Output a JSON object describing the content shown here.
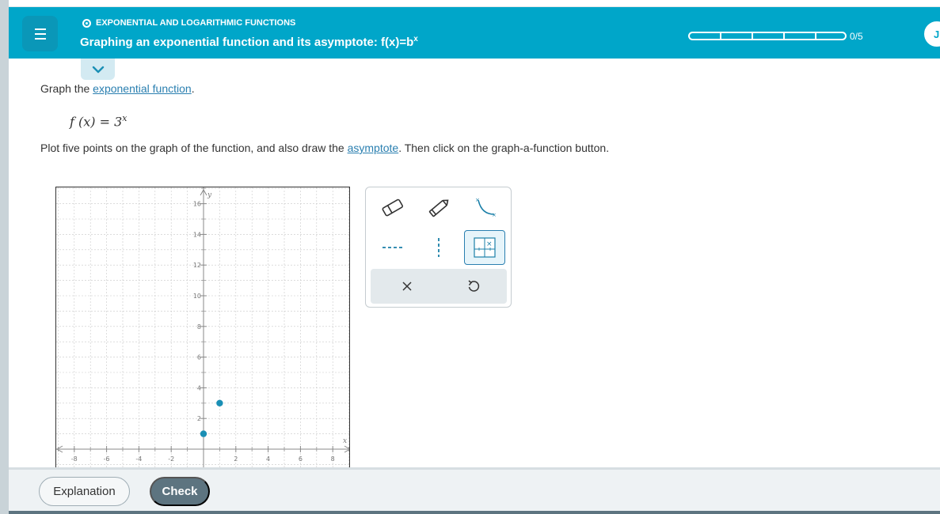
{
  "header": {
    "topic": "EXPONENTIAL AND LOGARITHMIC FUNCTIONS",
    "title": "Graphing an exponential function and its asymptote: f(x)=b",
    "title_sup": "x",
    "progress_text": "0/5",
    "progress": {
      "completed": 0,
      "total": 5
    },
    "avatar_initial": "J"
  },
  "question": {
    "instruction_prefix": "Graph the ",
    "instruction_link": "exponential function",
    "instruction_suffix": ".",
    "formula_lhs": "f (x) = 3",
    "formula_exp": "x",
    "plot_prefix": "Plot five points on the graph of the function, and also draw the ",
    "plot_link": "asymptote",
    "plot_suffix": ". Then click on the graph-a-function button."
  },
  "graph": {
    "x_label": "x",
    "y_label": "y",
    "x_ticks": [
      "-8",
      "-6",
      "-4",
      "-2",
      "2",
      "4",
      "6",
      "8"
    ],
    "y_ticks": [
      "2",
      "4",
      "6",
      "8",
      "10",
      "12",
      "14",
      "16"
    ],
    "x_range": [
      -9,
      9
    ],
    "y_range": [
      -0.6,
      17
    ],
    "plotted_points": [
      {
        "x": 0,
        "y": 1
      },
      {
        "x": 1,
        "y": 3
      }
    ]
  },
  "toolbox": {
    "tools": [
      "eraser-icon",
      "pencil-icon",
      "curve-tool-icon",
      "horizontal-asymptote-icon",
      "vertical-asymptote-icon",
      "graph-function-icon",
      "clear-icon",
      "undo-icon"
    ]
  },
  "footer": {
    "explanation_label": "Explanation",
    "check_label": "Check"
  },
  "colors": {
    "header": "#00a6c9",
    "point": "#1a8fb5",
    "button_dark": "#5d7480"
  }
}
